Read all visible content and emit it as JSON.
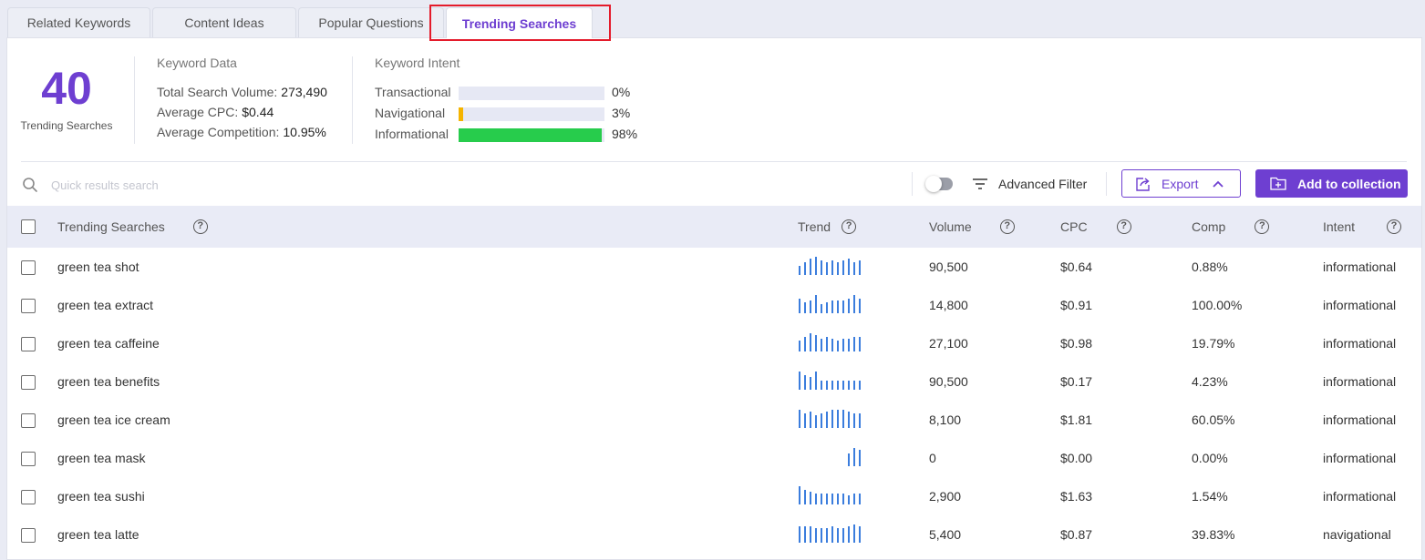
{
  "tabs": [
    {
      "label": "Related Keywords",
      "active": false
    },
    {
      "label": "Content Ideas",
      "active": false
    },
    {
      "label": "Popular Questions",
      "active": false
    },
    {
      "label": "Trending Searches",
      "active": true
    }
  ],
  "summary": {
    "count": "40",
    "count_label": "Trending Searches",
    "keyword_data": {
      "title": "Keyword Data",
      "total_volume_label": "Total Search Volume:",
      "total_volume": "273,490",
      "avg_cpc_label": "Average CPC:",
      "avg_cpc": "$0.44",
      "avg_comp_label": "Average Competition:",
      "avg_comp": "10.95%"
    },
    "keyword_intent": {
      "title": "Keyword Intent",
      "items": [
        {
          "label": "Transactional",
          "pct": "0%",
          "value": 0,
          "color": "#e6e8f4"
        },
        {
          "label": "Navigational",
          "pct": "3%",
          "value": 3,
          "color": "#f5b400"
        },
        {
          "label": "Informational",
          "pct": "98%",
          "value": 98,
          "color": "#27cc4c"
        }
      ]
    }
  },
  "toolbar": {
    "search_placeholder": "Quick results search",
    "advanced_filter_label": "Advanced Filter",
    "export_label": "Export",
    "add_collection_label": "Add to collection"
  },
  "table": {
    "headers": {
      "keyword": "Trending Searches",
      "trend": "Trend",
      "volume": "Volume",
      "cpc": "CPC",
      "comp": "Comp",
      "intent": "Intent"
    },
    "rows": [
      {
        "keyword": "green tea shot",
        "volume": "90,500",
        "cpc": "$0.64",
        "comp": "0.88%",
        "intent": "informational",
        "trend": [
          10,
          14,
          18,
          20,
          16,
          14,
          16,
          14,
          16,
          18,
          14,
          16
        ]
      },
      {
        "keyword": "green tea extract",
        "volume": "14,800",
        "cpc": "$0.91",
        "comp": "100.00%",
        "intent": "informational",
        "trend": [
          16,
          12,
          14,
          20,
          10,
          12,
          14,
          14,
          14,
          16,
          20,
          16
        ]
      },
      {
        "keyword": "green tea caffeine",
        "volume": "27,100",
        "cpc": "$0.98",
        "comp": "19.79%",
        "intent": "informational",
        "trend": [
          12,
          16,
          20,
          18,
          14,
          16,
          14,
          12,
          14,
          14,
          16,
          16
        ]
      },
      {
        "keyword": "green tea benefits",
        "volume": "90,500",
        "cpc": "$0.17",
        "comp": "4.23%",
        "intent": "informational",
        "trend": [
          20,
          16,
          14,
          20,
          10,
          10,
          10,
          10,
          10,
          10,
          10,
          10
        ]
      },
      {
        "keyword": "green tea ice cream",
        "volume": "8,100",
        "cpc": "$1.81",
        "comp": "60.05%",
        "intent": "informational",
        "trend": [
          20,
          16,
          18,
          14,
          16,
          18,
          20,
          20,
          20,
          18,
          16,
          16
        ]
      },
      {
        "keyword": "green tea mask",
        "volume": "0",
        "cpc": "$0.00",
        "comp": "0.00%",
        "intent": "informational",
        "trend": [
          0,
          0,
          0,
          0,
          0,
          0,
          0,
          0,
          0,
          14,
          20,
          18
        ]
      },
      {
        "keyword": "green tea sushi",
        "volume": "2,900",
        "cpc": "$1.63",
        "comp": "1.54%",
        "intent": "informational",
        "trend": [
          20,
          16,
          14,
          12,
          12,
          12,
          12,
          12,
          12,
          10,
          12,
          12
        ]
      },
      {
        "keyword": "green tea latte",
        "volume": "5,400",
        "cpc": "$0.87",
        "comp": "39.83%",
        "intent": "navigational",
        "trend": [
          18,
          18,
          18,
          16,
          16,
          16,
          18,
          16,
          16,
          18,
          20,
          18
        ]
      }
    ]
  },
  "colors": {
    "accent": "#6e3fd1",
    "trend_bar": "#3b7ddd",
    "highlight": "#e41b2b"
  }
}
